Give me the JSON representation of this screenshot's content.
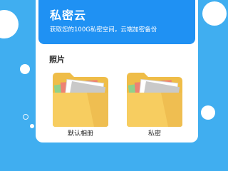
{
  "header": {
    "title": "私密云",
    "subtitle": "获取您的100G私密空间，云端加密备份"
  },
  "section": {
    "title": "照片"
  },
  "albums": [
    {
      "label": "默认相册",
      "icon": "folder-photos-icon"
    },
    {
      "label": "私密",
      "icon": "folder-photos-icon"
    }
  ],
  "colors": {
    "background": "#40aef0",
    "header": "#1f91f3",
    "folder_back": "#efbd48",
    "folder_front": "#f7cd60",
    "photo_green": "#8fd18c",
    "photo_red": "#ee8273",
    "photo_gray": "#c9c9c9"
  }
}
